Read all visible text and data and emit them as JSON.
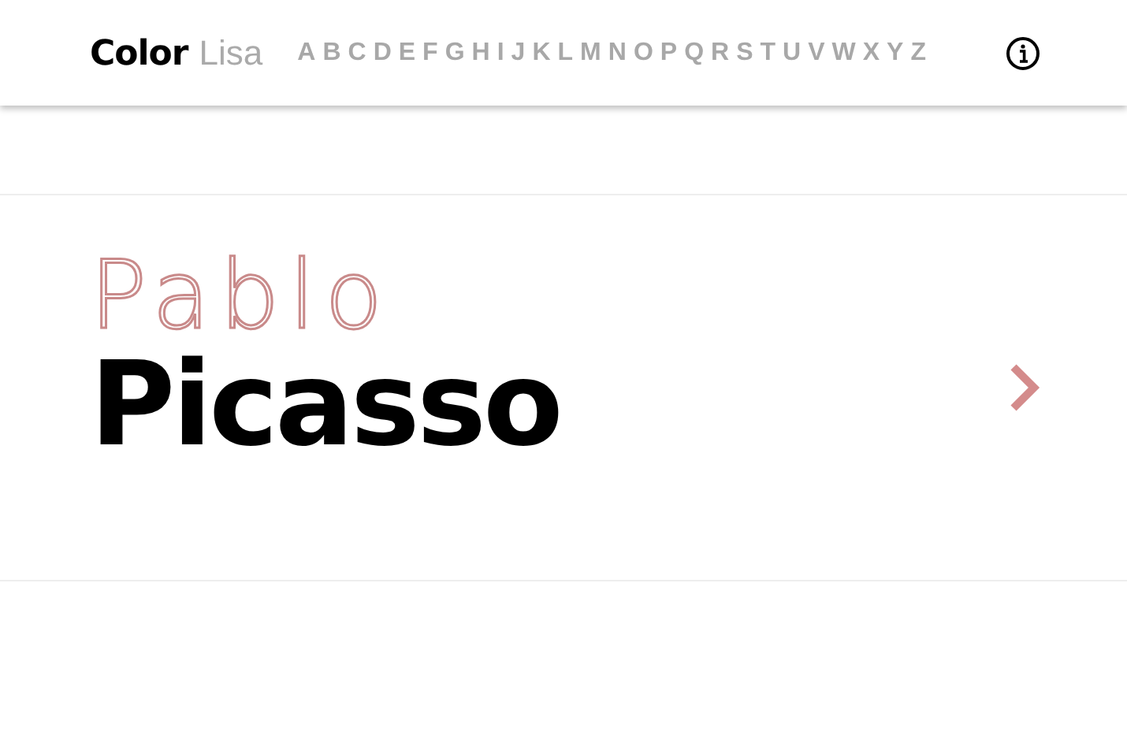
{
  "header": {
    "brand_bold": "Color",
    "brand_light": "Lisa",
    "letters": [
      "A",
      "B",
      "C",
      "D",
      "E",
      "F",
      "G",
      "H",
      "I",
      "J",
      "K",
      "L",
      "M",
      "N",
      "O",
      "P",
      "Q",
      "R",
      "S",
      "T",
      "U",
      "V",
      "W",
      "X",
      "Y",
      "Z"
    ]
  },
  "artists": [
    {
      "first_name": "Pablo",
      "last_name": "Picasso",
      "arrow": true
    }
  ]
}
